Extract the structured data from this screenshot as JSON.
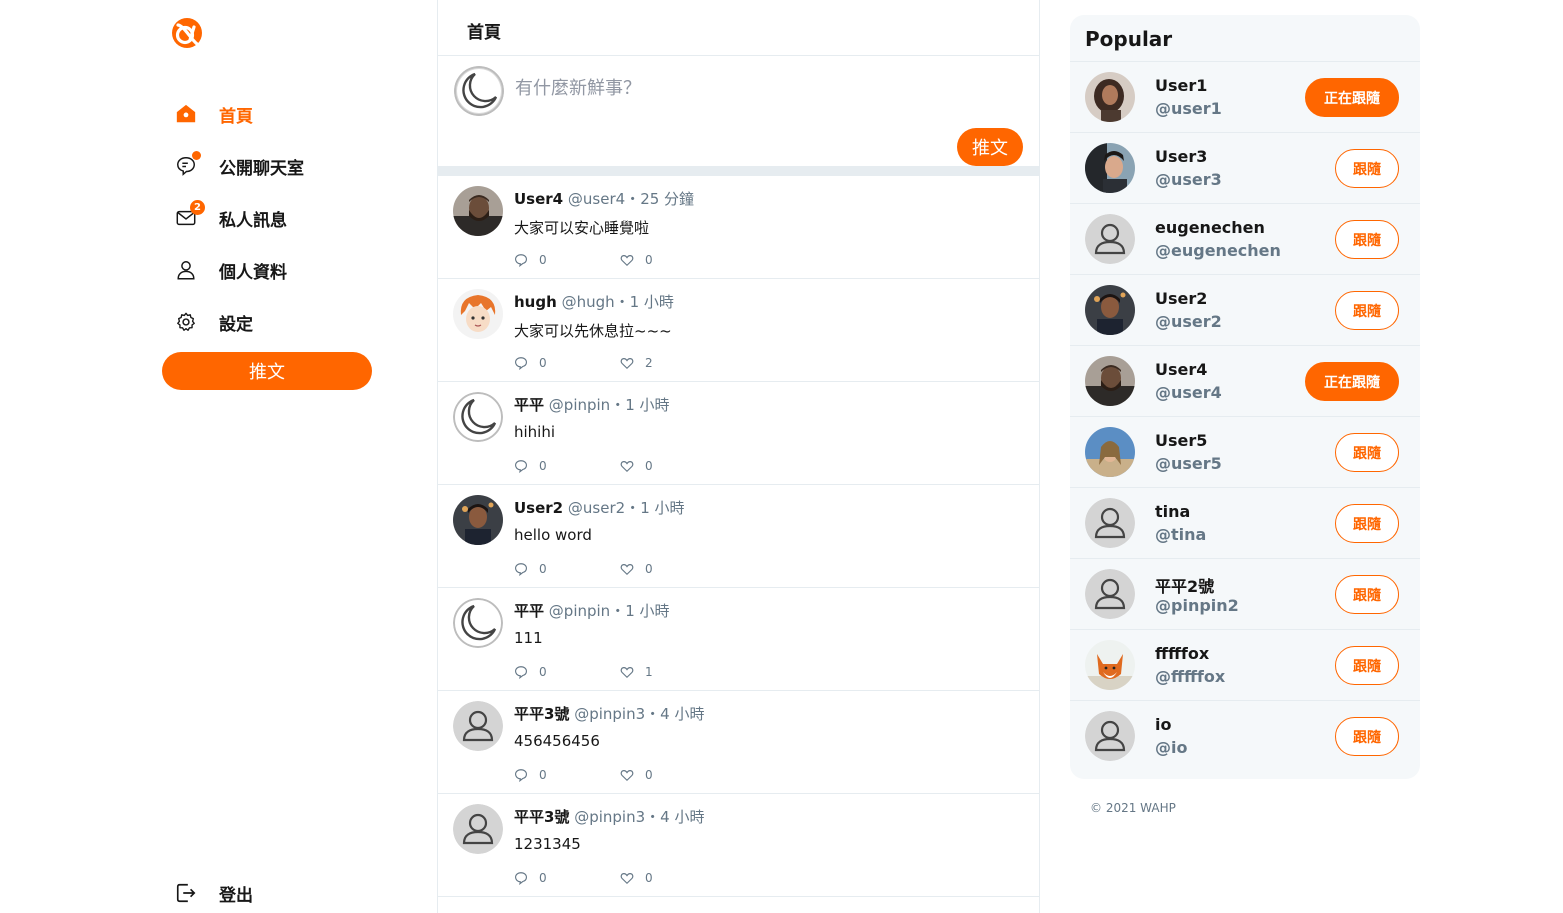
{
  "colors": {
    "accent": "#ff6600",
    "border": "#e6ecf0",
    "muted": "#657786",
    "panel": "#f5f8fa"
  },
  "nav": {
    "logo_icon": "alpha-logo-icon",
    "items": [
      {
        "label": "首頁",
        "icon": "home-icon",
        "active": true
      },
      {
        "label": "公開聊天室",
        "icon": "chat-bubble-icon",
        "dot": true
      },
      {
        "label": "私人訊息",
        "icon": "envelope-icon",
        "badge": "2"
      },
      {
        "label": "個人資料",
        "icon": "user-icon"
      },
      {
        "label": "設定",
        "icon": "gear-icon"
      }
    ],
    "tweet_button": "推文",
    "logout": {
      "label": "登出",
      "icon": "logout-icon"
    }
  },
  "feed": {
    "title": "首頁",
    "composer": {
      "placeholder": "有什麼新鮮事？",
      "button": "推文",
      "avatar": "moon-avatar"
    },
    "tweets": [
      {
        "name": "User4",
        "handle": "@user4",
        "time": "25 分鐘",
        "text": "大家可以安心睡覺啦",
        "replies": "0",
        "likes": "0",
        "avatar": "user4-photo"
      },
      {
        "name": "hugh",
        "handle": "@hugh",
        "time": "1 小時",
        "text": "大家可以先休息拉~~~",
        "replies": "0",
        "likes": "2",
        "avatar": "hugh-anime"
      },
      {
        "name": "平平",
        "handle": "@pinpin",
        "time": "1 小時",
        "text": "hihihi",
        "replies": "0",
        "likes": "0",
        "avatar": "moon-avatar"
      },
      {
        "name": "User2",
        "handle": "@user2",
        "time": "1 小時",
        "text": "hello word",
        "replies": "0",
        "likes": "0",
        "avatar": "user2-photo"
      },
      {
        "name": "平平",
        "handle": "@pinpin",
        "time": "1 小時",
        "text": "111",
        "replies": "0",
        "likes": "1",
        "avatar": "moon-avatar"
      },
      {
        "name": "平平3號",
        "handle": "@pinpin3",
        "time": "4 小時",
        "text": "456456456",
        "replies": "0",
        "likes": "0",
        "avatar": "default-avatar"
      },
      {
        "name": "平平3號",
        "handle": "@pinpin3",
        "time": "4 小時",
        "text": "1231345",
        "replies": "0",
        "likes": "0",
        "avatar": "default-avatar"
      }
    ]
  },
  "popular": {
    "title": "Popular",
    "users": [
      {
        "name": "User1",
        "handle": "@user1",
        "button": "正在跟隨",
        "following": true,
        "avatar": "user1-photo"
      },
      {
        "name": "User3",
        "handle": "@user3",
        "button": "跟隨",
        "following": false,
        "avatar": "user3-photo"
      },
      {
        "name": "eugenechen",
        "handle": "@eugenechen",
        "button": "跟隨",
        "following": false,
        "avatar": "default-avatar"
      },
      {
        "name": "User2",
        "handle": "@user2",
        "button": "跟隨",
        "following": false,
        "avatar": "user2-photo"
      },
      {
        "name": "User4",
        "handle": "@user4",
        "button": "正在跟隨",
        "following": true,
        "avatar": "user4-photo"
      },
      {
        "name": "User5",
        "handle": "@user5",
        "button": "跟隨",
        "following": false,
        "avatar": "user5-photo"
      },
      {
        "name": "tina",
        "handle": "@tina",
        "button": "跟隨",
        "following": false,
        "avatar": "default-avatar"
      },
      {
        "name": "平平2號",
        "handle": "@pinpin2",
        "button": "跟隨",
        "following": false,
        "avatar": "default-avatar"
      },
      {
        "name": "fffffox",
        "handle": "@fffffox",
        "button": "跟隨",
        "following": false,
        "avatar": "fox-photo"
      },
      {
        "name": "io",
        "handle": "@io",
        "button": "跟隨",
        "following": false,
        "avatar": "default-avatar"
      }
    ]
  },
  "footer": {
    "copyright": "© 2021 WAHP"
  }
}
